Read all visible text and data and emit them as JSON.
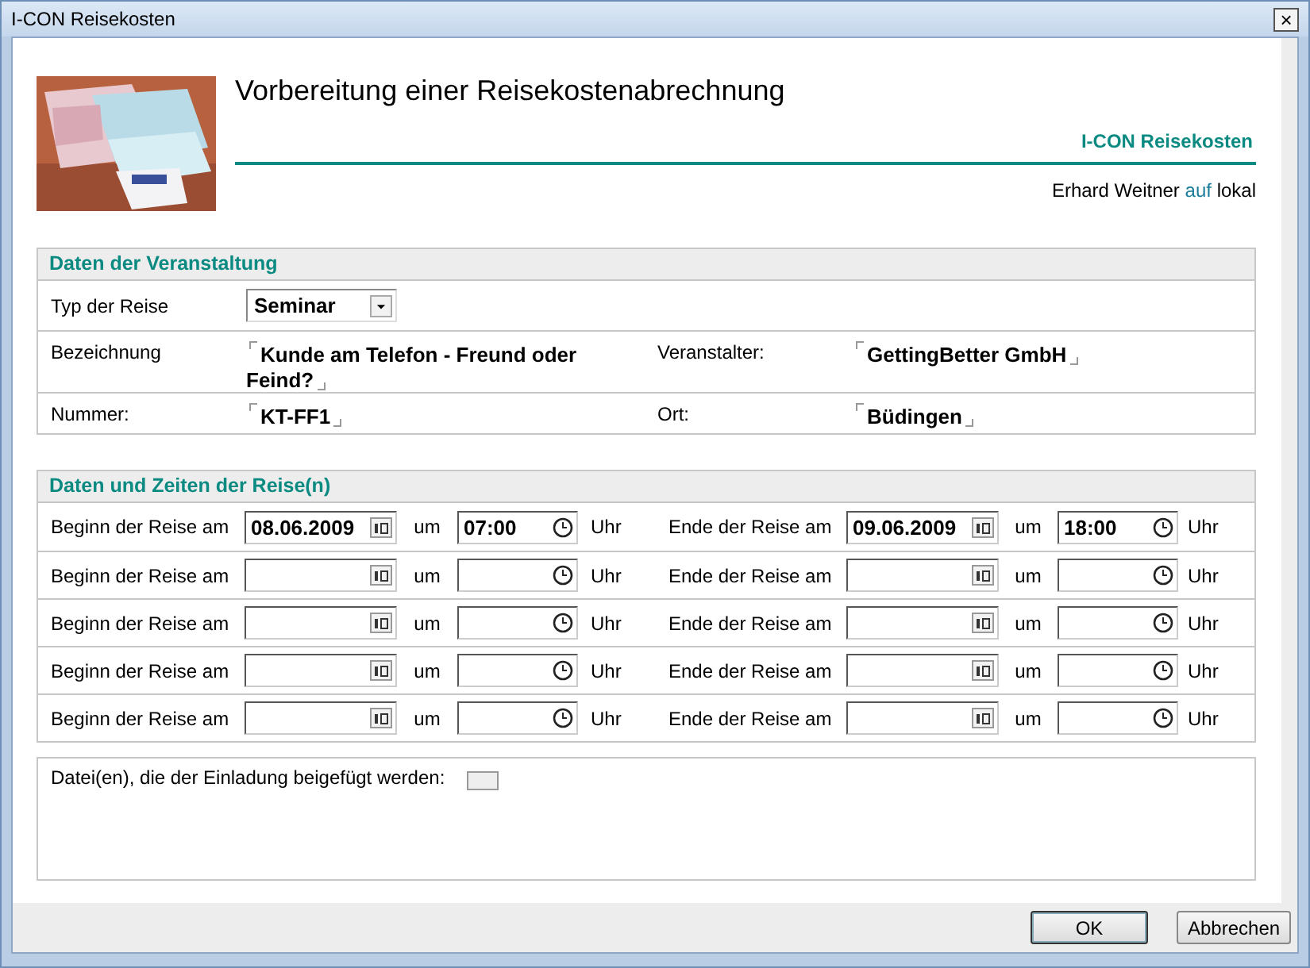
{
  "window": {
    "title": "I-CON Reisekosten",
    "close": "×"
  },
  "header": {
    "kind": "picture",
    "title": "Vorbereitung einer Reisekostenabrechnung",
    "brand": "I-CON Reisekosten",
    "user": "Erhard Weitner",
    "user_connector": "auf",
    "location": "lokal"
  },
  "event": {
    "heading": "Daten der Veranstaltung",
    "type_label": "Typ der Reise",
    "type_value": "Seminar",
    "fields": [
      {
        "label": "Bezeichnung",
        "value": "Kunde am Telefon - Freund oder Feind?",
        "label_2": "Veranstalter:",
        "value_2": "GettingBetter GmbH"
      },
      {
        "label": "Nummer:",
        "value": "KT-FF1",
        "label_2": "Ort:",
        "value_2": "Büdingen"
      }
    ]
  },
  "trips": {
    "heading": "Daten und Zeiten der Reise(n)",
    "rows": [
      {
        "begin_label": "Beginn der Reise am",
        "begin_date": "08.06.2009",
        "begin_at": "um",
        "begin_time": "07:00",
        "begin_unit": "Uhr",
        "end_label": "Ende der Reise am",
        "end_date": "09.06.2009",
        "end_at": "um",
        "end_time": "18:00",
        "end_unit": "Uhr"
      },
      {
        "begin_label": "Beginn der Reise am",
        "begin_at": "um",
        "begin_unit": "Uhr",
        "end_label": "Ende der Reise am",
        "end_at": "um",
        "end_unit": "Uhr"
      },
      {
        "begin_label": "Beginn der Reise am",
        "begin_at": "um",
        "begin_unit": "Uhr",
        "end_label": "Ende der Reise am",
        "end_at": "um",
        "end_unit": "Uhr"
      },
      {
        "begin_label": "Beginn der Reise am",
        "begin_at": "um",
        "begin_unit": "Uhr",
        "end_label": "Ende der Reise am",
        "end_at": "um",
        "end_unit": "Uhr"
      },
      {
        "begin_label": "Beginn der Reise am",
        "begin_at": "um",
        "begin_unit": "Uhr",
        "end_label": "Ende der Reise am",
        "end_at": "um",
        "end_unit": "Uhr"
      }
    ]
  },
  "attachments": {
    "label": "Datei(en), die der Einladung beigefügt werden:"
  },
  "buttons": [
    {
      "label": "OK",
      "default": true
    },
    {
      "label": "Abbrechen",
      "default": false
    }
  ]
}
